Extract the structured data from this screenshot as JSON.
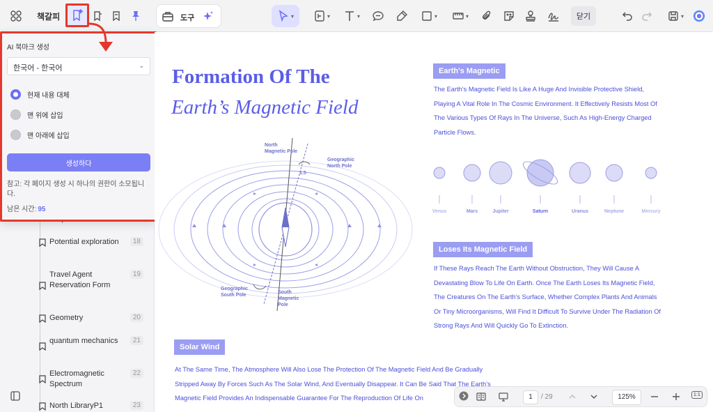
{
  "toolbar": {
    "bookmark_tab": "책갈피",
    "tool_label": "도구",
    "close_label": "닫기"
  },
  "ai_popup": {
    "title": "AI 북마크 생성",
    "language": "한국어 - 한국어",
    "options": [
      "현재 내용 대체",
      "맨 위에 삽입",
      "맨 아래에 삽입"
    ],
    "selected_option": "현재 내용 대체",
    "generate_label": "생성하다",
    "note": "참고: 각 페이지 생성 시 하나의 권한이 소모됩니다.",
    "time_label": "남은 시간:",
    "time_value": "95"
  },
  "bookmarks": [
    {
      "label": "Potential exploration",
      "page": "18"
    },
    {
      "label": "Travel Agent Reservation Form",
      "page": "19"
    },
    {
      "label": "Geometry",
      "page": "20"
    },
    {
      "label": "quantum mechanics",
      "page": "21"
    },
    {
      "label": "Electromagnetic Spectrum",
      "page": "22"
    },
    {
      "label": "North LibraryP1",
      "page": "23"
    }
  ],
  "bookmark_partial": "Speed",
  "document": {
    "title_line1": "Formation Of The",
    "title_line2": "Earth’s Magnetic Field",
    "diagram": {
      "north_pole": "North\nMagnetic Pole",
      "geo_north": "Geographic\nNorth Pole",
      "angle": "1.5",
      "geo_south": "Geographic\nSouth Pole",
      "south_pole": "South\nMagnetic\nPole"
    },
    "sections": {
      "magnetic": {
        "heading": "Earth's Magnetic",
        "text": "The Earth's Magnetic Field Is Like A Huge And Invisible Protective Shield, Playing A Vital Role In The Cosmic Environment. It Effectively Resists Most Of The Various Types Of Rays In The Universe, Such As High-Energy Charged Particle Flows."
      },
      "loses": {
        "heading": "Loses Its Magnetic Field",
        "text": "If These Rays Reach The Earth Without Obstruction, They Will Cause A Devastating Blow To Life On Earth. Once The Earth Loses Its Magnetic Field, The Creatures On The Earth's Surface, Whether Complex Plants And Animals Or Tiny Microorganisms, Will Find It Difficult To Survive Under The Radiation Of Strong Rays And Will Quickly Go To Extinction."
      },
      "solar": {
        "heading": "Solar Wind",
        "text": "At The Same Time, The Atmosphere Will Also Lose The Protection Of The Magnetic Field And Be Gradually Stripped Away By Forces Such As The Solar Wind, And Eventually Disappear. It Can Be Said That The Earth's Magnetic Field Provides An Indispensable Guarantee For The Reproduction Of Life On"
      }
    },
    "planets": [
      "Venus",
      "Mars",
      "Jupiter",
      "Saturn",
      "Uranus",
      "Neptune",
      "Mercury"
    ]
  },
  "bottom": {
    "page_current": "1",
    "page_total": "/ 29",
    "zoom": "125%",
    "fit_label": "1:1"
  },
  "colors": {
    "accent": "#6b6ff5",
    "doc_text": "#4b4fd8",
    "highlight": "#9a9df2",
    "annotation_red": "#e4382c"
  }
}
